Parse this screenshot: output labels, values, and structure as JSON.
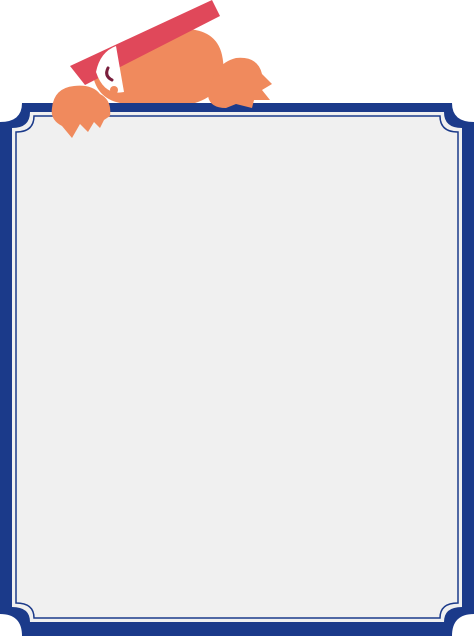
{
  "colors": {
    "frame_outer": "#1b3a8a",
    "frame_inner_line": "#1b3a8a",
    "panel_fill": "#f0f0f0",
    "background": "#ffffff",
    "mascot_body": "#f08a5d",
    "mascot_hat": "#e0485a",
    "mascot_face": "#ffffff",
    "mascot_eye": "#7a1f3d"
  },
  "icons": {
    "mascot": "peeking-cartoon-character-icon",
    "frame": "ornate-rounded-frame"
  }
}
